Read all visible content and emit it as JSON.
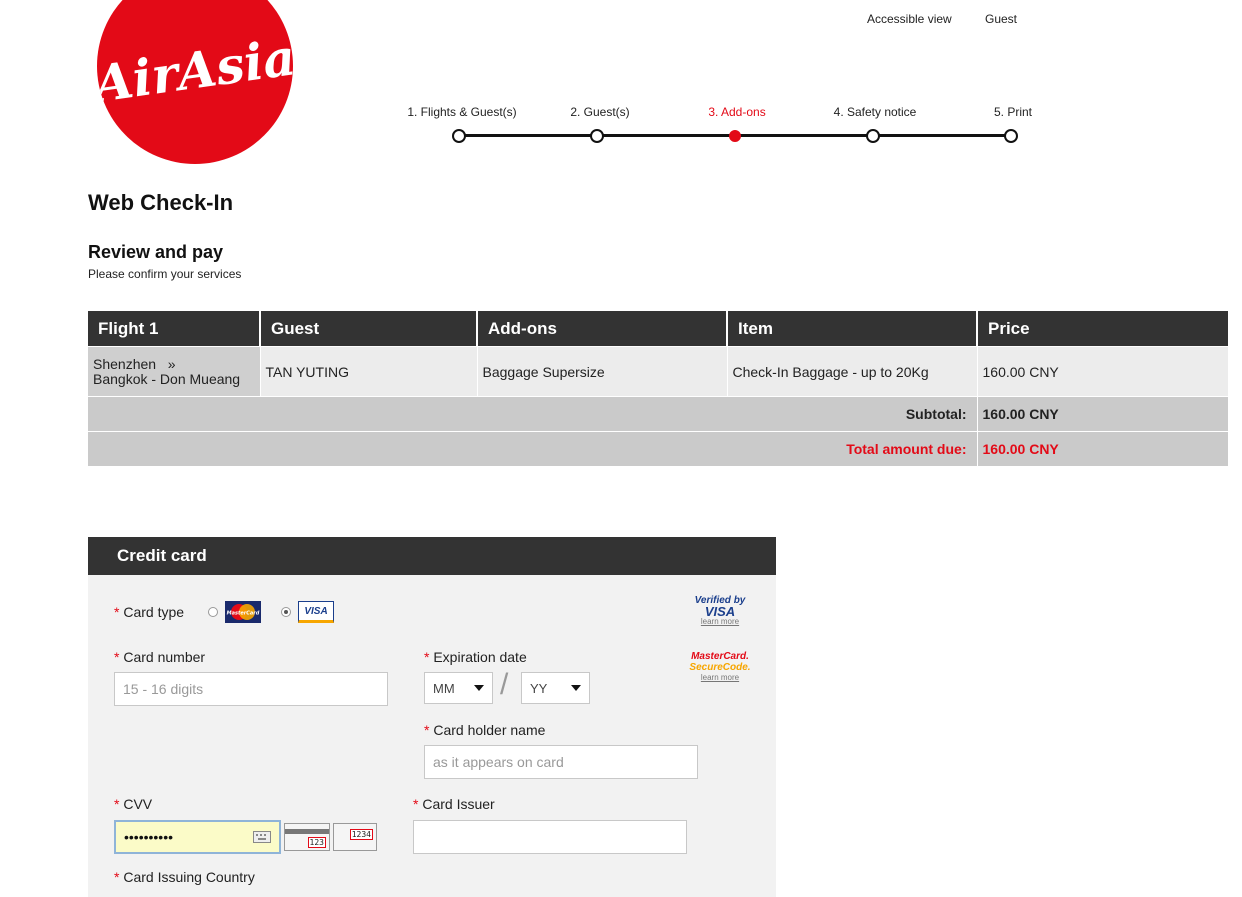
{
  "brand": {
    "logo_text": "AirAsia",
    "color": "#e30a17"
  },
  "top_links": {
    "accessible": "Accessible view",
    "guest": "Guest"
  },
  "stepper": {
    "steps": [
      {
        "label": "1. Flights & Guest(s)",
        "state": "done"
      },
      {
        "label": "2. Guest(s)",
        "state": "done"
      },
      {
        "label": "3. Add-ons",
        "state": "current"
      },
      {
        "label": "4. Safety notice",
        "state": "todo"
      },
      {
        "label": "5. Print",
        "state": "todo"
      }
    ]
  },
  "page": {
    "title": "Web Check-In",
    "section_title": "Review and pay",
    "section_subtitle": "Please confirm your services"
  },
  "summary": {
    "headers": [
      "Flight 1",
      "Guest",
      "Add-ons",
      "Item",
      "Price"
    ],
    "row": {
      "route_from": "Shenzhen",
      "route_arrow": "»",
      "route_to": "Bangkok - Don Mueang",
      "guest": "TAN YUTING",
      "addon": "Baggage Supersize",
      "item": "Check-In Baggage - up to 20Kg",
      "price": "160.00 CNY"
    },
    "subtotal_label": "Subtotal:",
    "subtotal_value": "160.00 CNY",
    "total_label": "Total amount due:",
    "total_value": "160.00 CNY"
  },
  "credit_card": {
    "title": "Credit card",
    "card_type_label": "Card type",
    "mastercard_logo": "MasterCard",
    "visa_logo": "VISA",
    "selected_card": "VISA",
    "card_number_label": "Card number",
    "card_number_placeholder": "15 - 16 digits",
    "expiration_label": "Expiration date",
    "exp_month": "MM",
    "exp_year": "YY",
    "exp_separator": "/",
    "holder_label": "Card holder name",
    "holder_placeholder": "as it appears on card",
    "cvv_label": "CVV",
    "cvv_value": "••••••••••",
    "cvv_hint_back": "123",
    "cvv_hint_front": "1234",
    "issuer_label": "Card Issuer",
    "issuer_value": "",
    "country_label": "Card Issuing Country",
    "verified_visa_line1": "Verified by",
    "verified_visa_line2": "VISA",
    "mc_secure_line1": "MasterCard.",
    "mc_secure_line2": "SecureCode.",
    "learn_more": "learn more",
    "required_mark": "*"
  }
}
